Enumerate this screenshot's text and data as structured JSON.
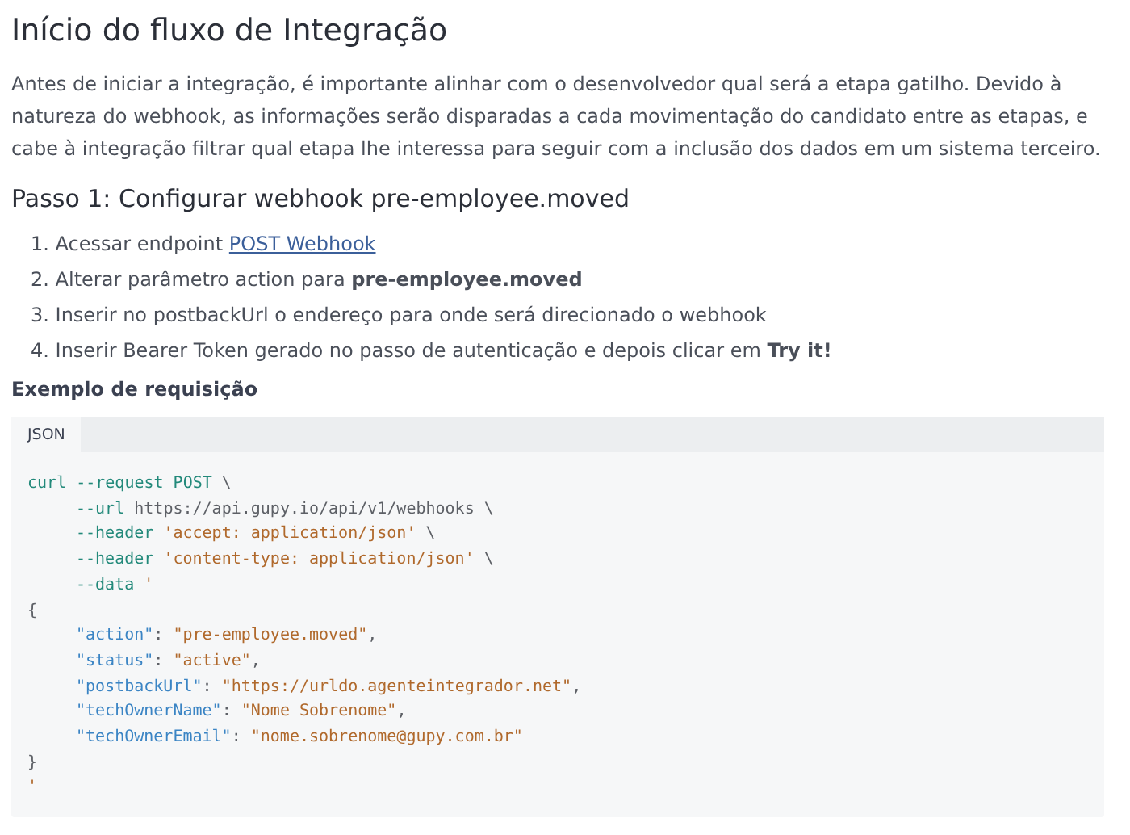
{
  "title": "Início do fluxo de Integração",
  "intro": "Antes de iniciar a integração, é importante alinhar com o desenvolvedor qual será a etapa gatilho. Devido à natureza do webhook, as informações serão disparadas a cada movimentação do candidato entre as etapas, e cabe à integração filtrar qual etapa lhe interessa para seguir com a inclusão dos dados em um sistema terceiro.",
  "step": {
    "title": "Passo 1: Configurar webhook pre-employee.moved",
    "items": [
      {
        "number": "1.",
        "text": "Acessar endpoint",
        "link": "POST Webhook"
      },
      {
        "number": "2.",
        "text": "Alterar parâmetro action para **pre-employee.moved**"
      },
      {
        "number": "3.",
        "text": "Inserir no postbackUrl o endereço para onde será direcionado o webhook"
      },
      {
        "number": "4.",
        "text": "Inserir Bearer Token gerado no passo de autenticação e depois clicar em **Try it!**"
      }
    ]
  },
  "example": {
    "label": "Exemplo de requisição",
    "tabs": [
      {
        "label": "JSON",
        "selected": true
      }
    ],
    "lines": [
      {
        "indented": false,
        "tokens": [
          {
            "kind": "kw",
            "text": "curl --request POST"
          },
          {
            "kind": "plain",
            "text": " \\"
          }
        ]
      },
      {
        "indented": true,
        "tokens": [
          {
            "kind": "kw",
            "text": "--url"
          },
          {
            "kind": "plain",
            "text": " https://api.gupy.io/api/v1/webhooks \\"
          }
        ]
      },
      {
        "indented": true,
        "tokens": [
          {
            "kind": "kw",
            "text": "--header"
          },
          {
            "kind": "str",
            "text": " 'accept: application/json'"
          },
          {
            "kind": "plain",
            "text": " \\"
          }
        ]
      },
      {
        "indented": true,
        "tokens": [
          {
            "kind": "kw",
            "text": "--header"
          },
          {
            "kind": "str",
            "text": " 'content-type: application/json'"
          },
          {
            "kind": "plain",
            "text": " \\"
          }
        ]
      },
      {
        "indented": true,
        "tokens": [
          {
            "kind": "kw",
            "text": "--data"
          },
          {
            "kind": "str",
            "text": " '"
          }
        ]
      },
      {
        "indented": false,
        "tokens": [
          {
            "kind": "plain",
            "text": "{"
          }
        ]
      },
      {
        "indented": true,
        "tokens": [
          {
            "kind": "key",
            "text": "\"action\""
          },
          {
            "kind": "plain",
            "text": ": "
          },
          {
            "kind": "str",
            "text": "\"pre-employee.moved\""
          },
          {
            "kind": "plain",
            "text": ","
          }
        ]
      },
      {
        "indented": true,
        "tokens": [
          {
            "kind": "key",
            "text": "\"status\""
          },
          {
            "kind": "plain",
            "text": ": "
          },
          {
            "kind": "str",
            "text": "\"active\""
          },
          {
            "kind": "plain",
            "text": ","
          }
        ]
      },
      {
        "indented": true,
        "tokens": [
          {
            "kind": "key",
            "text": "\"postbackUrl\""
          },
          {
            "kind": "plain",
            "text": ": "
          },
          {
            "kind": "str",
            "text": "\"https://urldo.agenteintegrador.net\""
          },
          {
            "kind": "plain",
            "text": ","
          }
        ]
      },
      {
        "indented": true,
        "tokens": [
          {
            "kind": "key",
            "text": "\"techOwnerName\""
          },
          {
            "kind": "plain",
            "text": ": "
          },
          {
            "kind": "str",
            "text": "\"Nome Sobrenome\""
          },
          {
            "kind": "plain",
            "text": ","
          }
        ]
      },
      {
        "indented": true,
        "tokens": [
          {
            "kind": "key",
            "text": "\"techOwnerEmail\""
          },
          {
            "kind": "plain",
            "text": ": "
          },
          {
            "kind": "str",
            "text": "\"nome.sobrenome@gupy.com.br\""
          }
        ]
      },
      {
        "indented": false,
        "tokens": [
          {
            "kind": "plain",
            "text": "}"
          }
        ]
      },
      {
        "indented": false,
        "tokens": [
          {
            "kind": "str",
            "text": "'"
          }
        ]
      }
    ]
  }
}
